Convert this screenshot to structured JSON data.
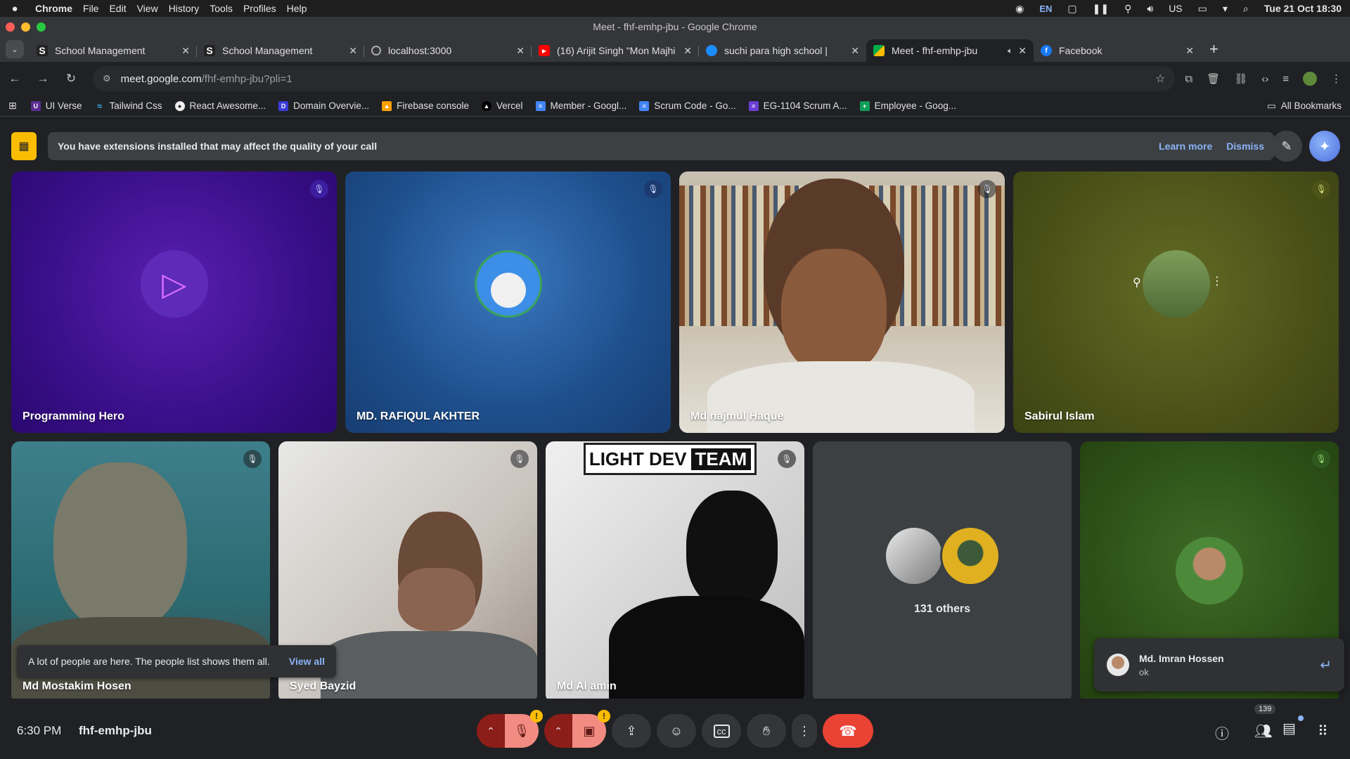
{
  "menubar": {
    "app": "Chrome",
    "items": [
      "File",
      "Edit",
      "View",
      "History",
      "Tools",
      "Profiles",
      "Help"
    ],
    "lang": "EN",
    "kbd": "US",
    "datetime": "Tue 21 Oct 18:30"
  },
  "window": {
    "title": "Meet - fhf-emhp-jbu - Google Chrome"
  },
  "tabs": [
    {
      "label": "School Management",
      "icon": "s-logo-icon"
    },
    {
      "label": "School Management",
      "icon": "s-logo-icon"
    },
    {
      "label": "localhost:3000",
      "icon": "globe-icon"
    },
    {
      "label": "(16) Arijit Singh \"Mon Majhi",
      "icon": "youtube-icon"
    },
    {
      "label": "suchi para high school |",
      "icon": "blue-dot-icon"
    },
    {
      "label": "Meet - fhf-emhp-jbu",
      "icon": "meet-icon"
    },
    {
      "label": "Facebook",
      "icon": "facebook-icon"
    }
  ],
  "omnibox": {
    "host": "meet.google.com",
    "path": "/fhf-emhp-jbu?pli=1"
  },
  "bookmarks": [
    "UI Verse",
    "Tailwind Css",
    "React Awesome...",
    "Domain Overvie...",
    "Firebase console",
    "Vercel",
    "Member - Googl...",
    "Scrum Code - Go...",
    "EG-1104 Scrum A...",
    "Employee - Goog..."
  ],
  "all_bookmarks": "All Bookmarks",
  "banner": {
    "text": "You have extensions installed that may affect the quality of your call",
    "learn_more": "Learn more",
    "dismiss": "Dismiss"
  },
  "participants": {
    "p1": "Programming Hero",
    "p2": "MD. RAFIQUL AKHTER",
    "p3": "Md najmul Haque",
    "p4": "Sabirul Islam",
    "p5": "Md Mostakim Hosen",
    "p6": "Syed Bayzid",
    "p7": "Md Al amin",
    "others": "131 others"
  },
  "video_text": {
    "team_sign": [
      "LIGHT DEV",
      "TEAM"
    ]
  },
  "toast": {
    "text": "A lot of people are here. The people list shows them all.",
    "link": "View all"
  },
  "chat": {
    "author": "Md. Imran Hossen",
    "message": "ok"
  },
  "bottom": {
    "time": "6:30 PM",
    "meeting_code": "fhf-emhp-jbu",
    "people_count": "139"
  },
  "colors": {
    "end_call": "#ea4335",
    "mic_off": "#f28b82",
    "warn": "#fbbc04",
    "link": "#8ab4f8"
  }
}
